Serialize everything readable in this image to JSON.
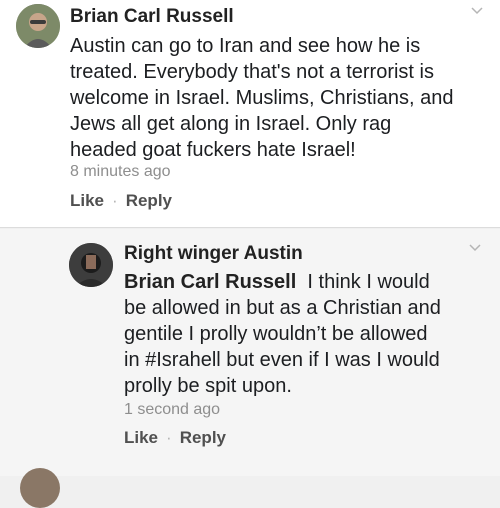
{
  "comments": [
    {
      "author": "Brian Carl Russell",
      "text_lines": [
        "Austin can go to Iran and see how he is",
        "treated. Everybody that's not a terrorist is",
        "welcome in Israel. Muslims, Christians, and",
        "Jews all get along in Israel. Only rag",
        "headed goat fuckers hate Israel!"
      ],
      "timestamp": "8 minutes ago",
      "like_label": "Like",
      "reply_label": "Reply",
      "avatar_icon": "profile-photo",
      "menu_icon": "chevron-down-icon"
    },
    {
      "author": "Right winger Austin",
      "mention": "Brian Carl Russell",
      "text_lines": [
        "I think I would",
        "be allowed in but as a Christian and",
        "gentile I prolly wouldn’t be allowed",
        "in #Israhell but even if I was I would",
        "prolly be spit upon."
      ],
      "timestamp": "1 second ago",
      "like_label": "Like",
      "reply_label": "Reply",
      "avatar_icon": "profile-photo",
      "menu_icon": "chevron-down-icon"
    }
  ],
  "separator": "·"
}
